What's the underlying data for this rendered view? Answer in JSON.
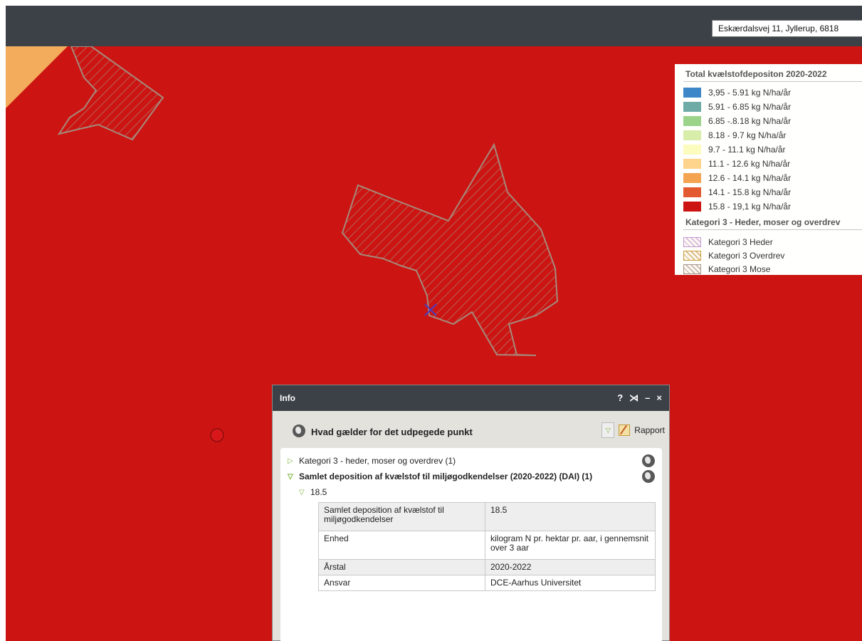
{
  "search": {
    "value": "Eskærdalsvej 11, Jyllerup, 6818"
  },
  "map": {
    "colors": {
      "background": "#cc1512",
      "corner_zone": "#f3ab5c",
      "hatch": "#a68a7c",
      "marker_cross": "#4a3bbf"
    },
    "icons": [
      "location-cross-marker",
      "red-circle-marker"
    ]
  },
  "legend": {
    "title": "Total kvælstofdepositon 2020-2022",
    "classes": [
      {
        "label": "3,95 - 5.91 kg N/ha/år",
        "color": "#3d86c8"
      },
      {
        "label": "5.91 - 6.85 kg N/ha/år",
        "color": "#6eaaa6"
      },
      {
        "label": "6.85 -.8.18 kg N/ha/år",
        "color": "#9cd38b"
      },
      {
        "label": "8.18 - 9.7 kg N/ha/år",
        "color": "#d8edaa"
      },
      {
        "label": "9.7 - 11.1 kg N/ha/år",
        "color": "#fdfcbf"
      },
      {
        "label": "11.1 - 12.6 kg N/ha/år",
        "color": "#fed38b"
      },
      {
        "label": "12.6 - 14.1 kg N/ha/år",
        "color": "#f4a451"
      },
      {
        "label": "14.1 - 15.8 kg N/ha/år",
        "color": "#e45a30"
      },
      {
        "label": "15.8 - 19,1 kg N/ha/år",
        "color": "#cc1512"
      }
    ],
    "section_title": "Kategori 3 - Heder, moser og overdrev",
    "categories": [
      {
        "label": "Kategori 3 Heder",
        "color": "#c49ad6"
      },
      {
        "label": "Kategori 3 Overdrev",
        "color": "#c89a3a"
      },
      {
        "label": "Kategori 3 Mose",
        "color": "#a6978a"
      }
    ]
  },
  "info": {
    "title": "Info",
    "controls": {
      "help": "?",
      "dock": "⋊",
      "minimize": "–",
      "close": "×"
    },
    "subtitle": "Hvad gælder for det udpegede punkt",
    "rapport_label": "Rapport",
    "tree": [
      {
        "label": "Kategori 3 - heder, moser og overdrev (1)",
        "expanded": false
      },
      {
        "label": "Samlet deposition af kvælstof til miljøgodkendelser (2020-2022) (DAI) (1)",
        "expanded": true
      }
    ],
    "value_node": "18.5",
    "table": [
      {
        "key": "Samlet deposition af kvælstof til miljøgodkendelser",
        "value": "18.5"
      },
      {
        "key": "Enhed",
        "value": "kilogram N pr. hektar pr. aar, i gennemsnit over 3 aar"
      },
      {
        "key": "Årstal",
        "value": "2020-2022"
      },
      {
        "key": "Ansvar",
        "value": "DCE-Aarhus Universitet"
      }
    ]
  }
}
